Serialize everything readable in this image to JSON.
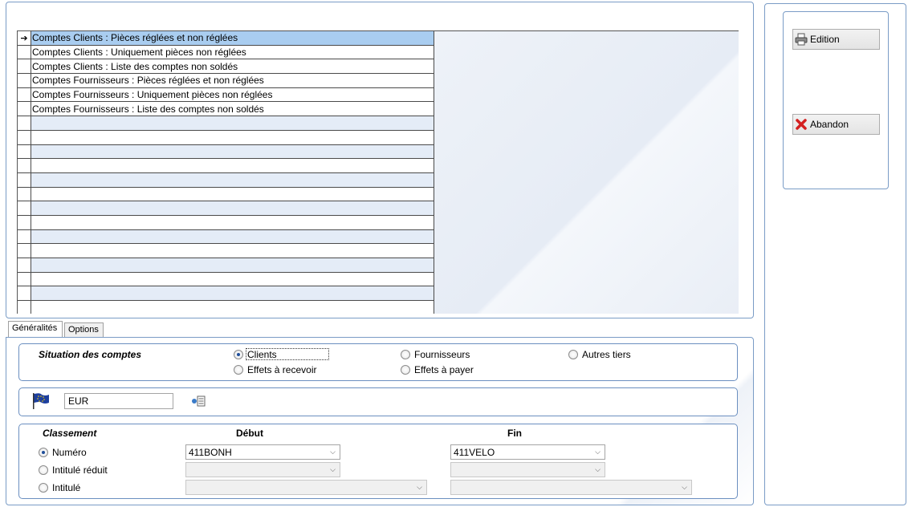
{
  "grid": {
    "rows": [
      "Comptes Clients : Pièces réglées et non réglées",
      "Comptes Clients : Uniquement pièces non réglées",
      "Comptes Clients : Liste des comptes non soldés",
      "Comptes Fournisseurs : Pièces réglées et non réglées",
      "Comptes Fournisseurs : Uniquement pièces non réglées",
      "Comptes Fournisseurs : Liste des comptes non soldés"
    ],
    "selected_index": 0,
    "current_row_marker": "➔"
  },
  "tabs": {
    "generalites": "Généralités",
    "options": "Options"
  },
  "situation": {
    "title": "Situation des comptes",
    "clients": "Clients",
    "fournisseurs": "Fournisseurs",
    "autres_tiers": "Autres tiers",
    "effets_recevoir": "Effets à recevoir",
    "effets_payer": "Effets à payer",
    "selected": "Clients"
  },
  "devise": {
    "value": "EUR",
    "flag_icon": "eu-flag-icon",
    "lookup_icon": "currency-list-icon"
  },
  "classement": {
    "title": "Classement",
    "debut_header": "Début",
    "fin_header": "Fin",
    "numero": "Numéro",
    "intitule_reduit": "Intitulé réduit",
    "intitule": "Intitulé",
    "selected": "Numéro",
    "numero_debut": "411BONH",
    "numero_fin": "411VELO"
  },
  "actions": {
    "edition": "Edition",
    "abandon": "Abandon"
  },
  "colors": {
    "border": "#7a9cc6",
    "selection": "#a9cdf0",
    "row_alt": "#e4ecf7"
  }
}
